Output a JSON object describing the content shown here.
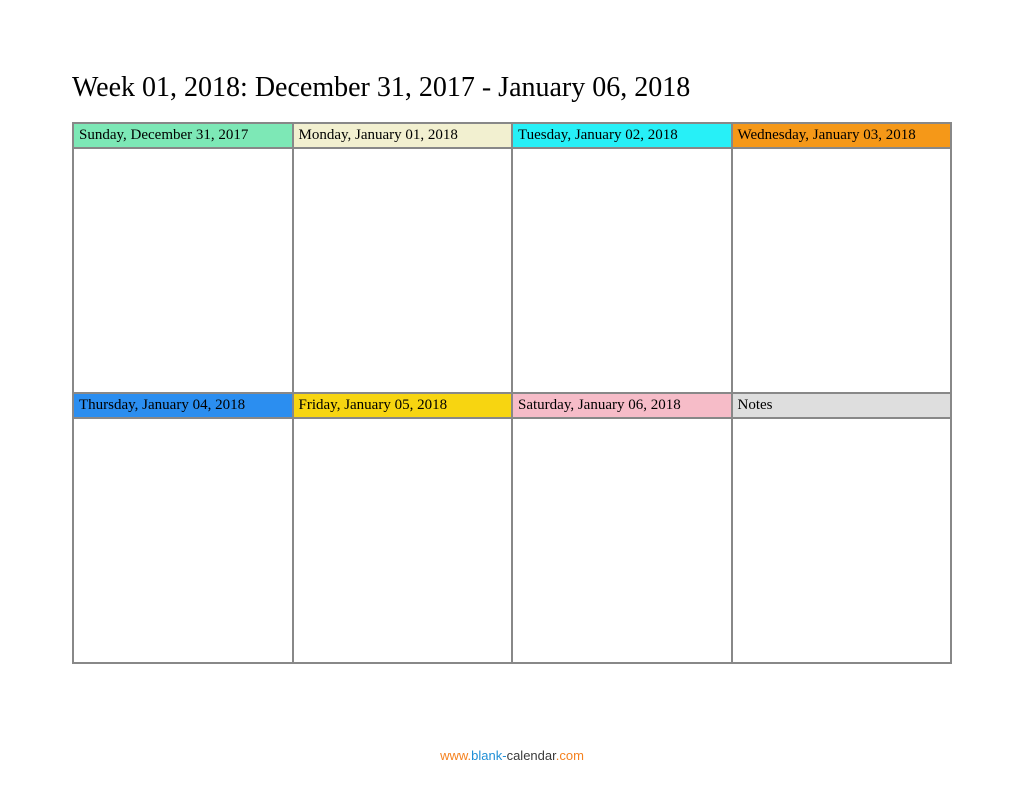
{
  "title": "Week 01, 2018: December 31, 2017 - January 06, 2018",
  "days": [
    {
      "label": "Sunday, December 31, 2017",
      "color": "#7de8b6"
    },
    {
      "label": "Monday, January 01, 2018",
      "color": "#f2f0d0"
    },
    {
      "label": "Tuesday, January 02, 2018",
      "color": "#27f0f7"
    },
    {
      "label": "Wednesday, January 03, 2018",
      "color": "#f59818"
    },
    {
      "label": "Thursday, January 04, 2018",
      "color": "#2b8ef0"
    },
    {
      "label": "Friday, January 05, 2018",
      "color": "#f7d511"
    },
    {
      "label": "Saturday, January 06, 2018",
      "color": "#f6bcc8"
    },
    {
      "label": "Notes",
      "color": "#dedede"
    }
  ],
  "footer": {
    "www": "www.",
    "blank": "blank",
    "dash": "-",
    "calendar": "calendar",
    "com": ".com"
  }
}
